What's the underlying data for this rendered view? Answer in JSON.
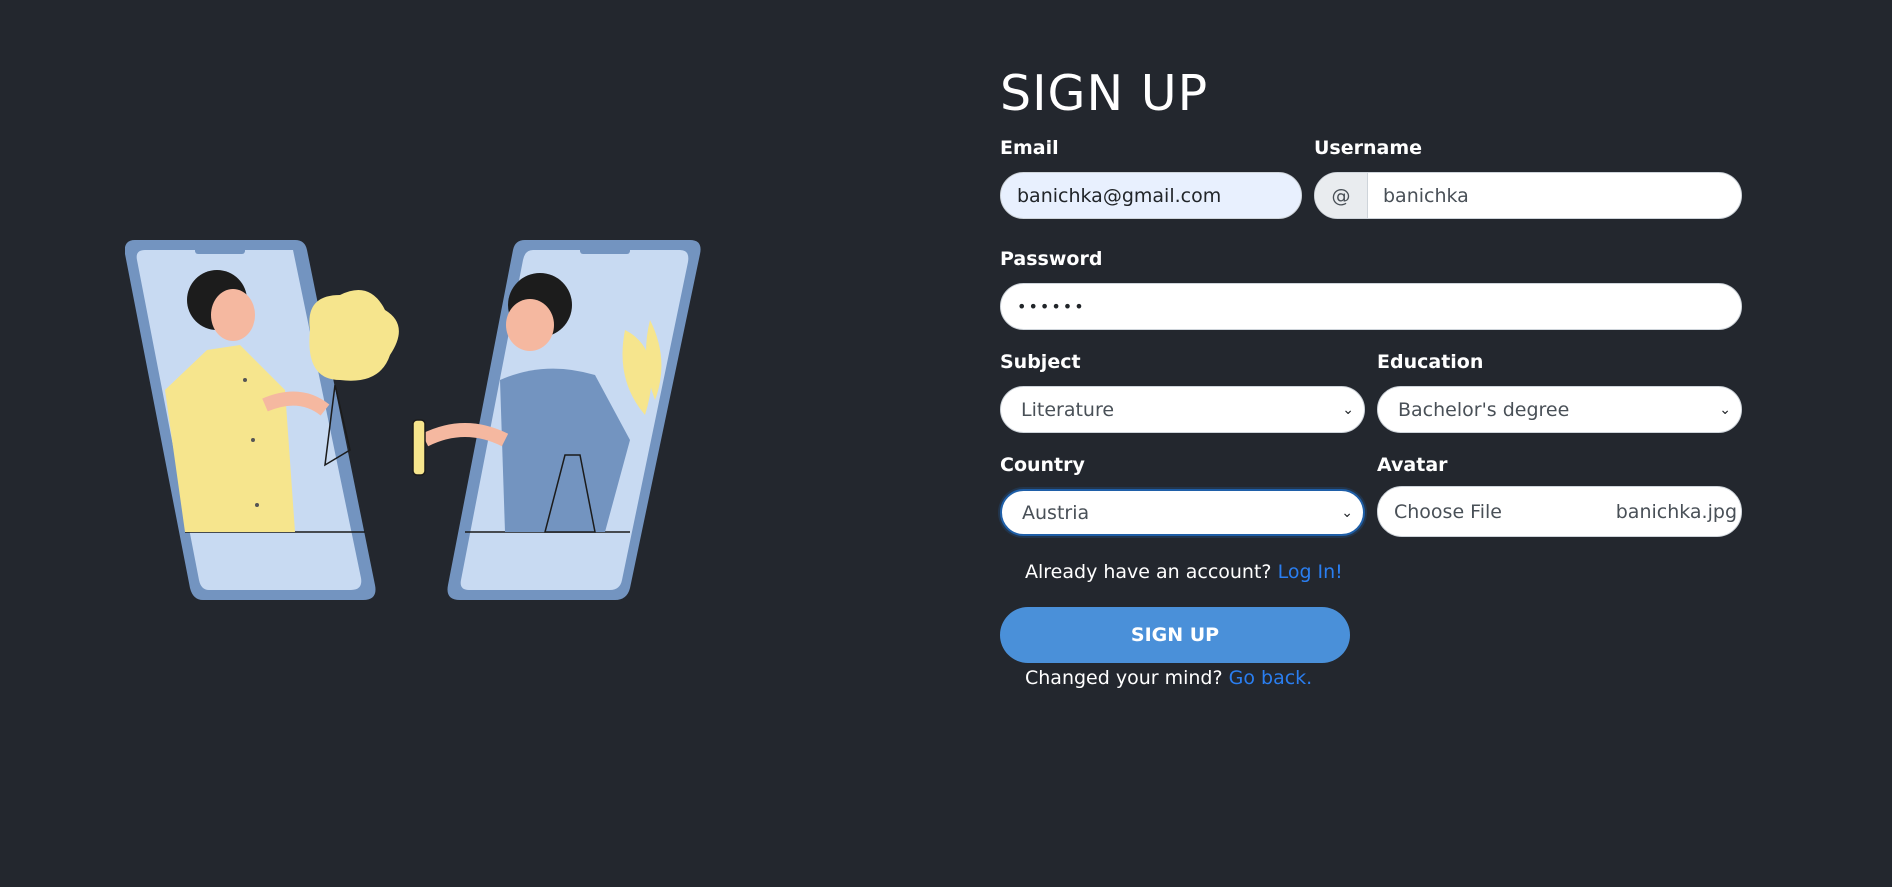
{
  "title": "SIGN UP",
  "email": {
    "label": "Email",
    "value": "banichka@gmail.com"
  },
  "username": {
    "label": "Username",
    "prefix": "@",
    "value": "banichka"
  },
  "password": {
    "label": "Password",
    "value": "••••••"
  },
  "subject": {
    "label": "Subject",
    "value": "Literature"
  },
  "education": {
    "label": "Education",
    "value": "Bachelor's degree"
  },
  "country": {
    "label": "Country",
    "value": "Austria"
  },
  "avatar": {
    "label": "Avatar",
    "button_label": "Choose File",
    "file_name": "banichka.jpg"
  },
  "login_prompt": {
    "text": "Already have an account?",
    "link": "Log In!"
  },
  "submit": {
    "label": "SIGN UP"
  },
  "back_prompt": {
    "text": "Changed your mind?",
    "link": "Go back."
  },
  "colors": {
    "background": "#23272e",
    "accent_button": "#4a90d9",
    "link": "#2a7ef0",
    "illustration_phone": "#7394c0",
    "illustration_screen": "#c8daf2",
    "illustration_yellow": "#f6e58d",
    "illustration_skin": "#f5b8a0"
  }
}
